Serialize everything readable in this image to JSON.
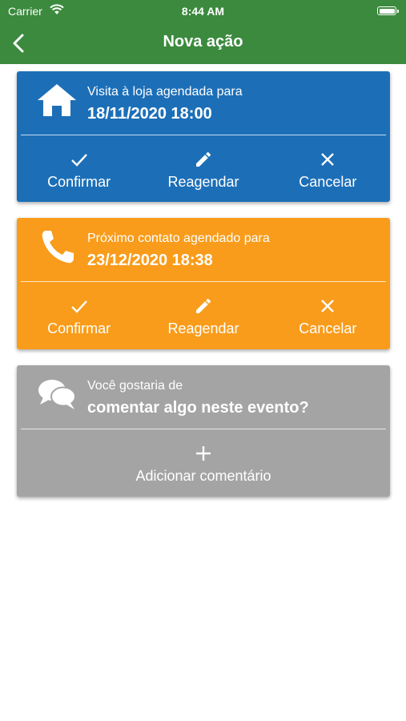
{
  "status_bar": {
    "carrier": "Carrier",
    "time": "8:44 AM"
  },
  "nav": {
    "title": "Nova ação"
  },
  "cards": [
    {
      "icon": "home-icon",
      "color": "#1c6fb7",
      "line1": "Visita à loja agendada para",
      "line2": "18/11/2020 18:00",
      "actions": [
        {
          "icon": "check-icon",
          "label": "Confirmar"
        },
        {
          "icon": "pencil-icon",
          "label": "Reagendar"
        },
        {
          "icon": "close-icon",
          "label": "Cancelar"
        }
      ]
    },
    {
      "icon": "phone-icon",
      "color": "#f99c1b",
      "line1": "Próximo contato agendado para",
      "line2": "23/12/2020 18:38",
      "actions": [
        {
          "icon": "check-icon",
          "label": "Confirmar"
        },
        {
          "icon": "pencil-icon",
          "label": "Reagendar"
        },
        {
          "icon": "close-icon",
          "label": "Cancelar"
        }
      ]
    },
    {
      "icon": "comments-icon",
      "color": "#a4a4a4",
      "line1": "Você gostaria de",
      "line2": "comentar algo neste evento?",
      "actions": [
        {
          "icon": "plus-icon",
          "label": "Adicionar comentário"
        }
      ]
    }
  ],
  "colors": {
    "header_green": "#3b8a3e",
    "background": "#ffffff"
  }
}
